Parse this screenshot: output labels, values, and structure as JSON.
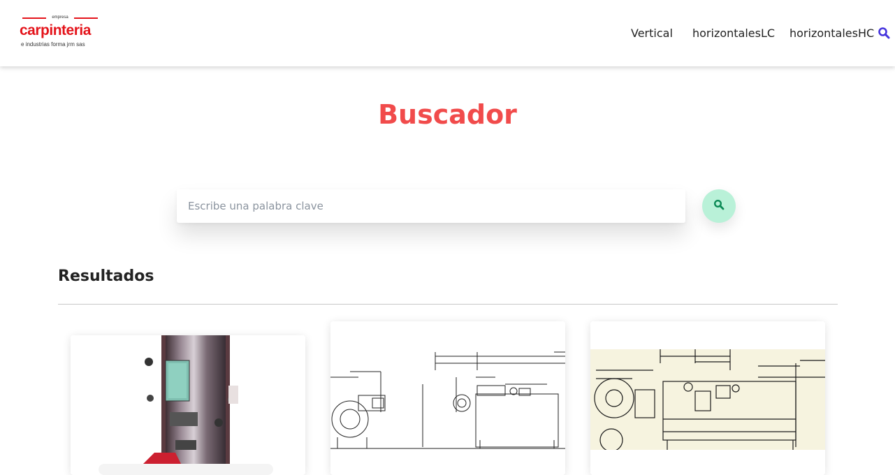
{
  "header": {
    "logo": {
      "small": "empresa",
      "brand": "carpinteria",
      "sub": "e industrias forma jrm sas"
    },
    "nav": [
      {
        "label": "Vertical"
      },
      {
        "label": "horizontalesLC"
      },
      {
        "label": "horizontalesHC"
      }
    ],
    "search_icon": "search-icon"
  },
  "main": {
    "title": "Buscador",
    "search": {
      "placeholder": "Escribe una palabra clave",
      "value": "",
      "button_icon": "search-icon"
    },
    "results_title": "Resultados",
    "results": [
      {
        "image": "vertical-boiler-photo"
      },
      {
        "image": "horizontal-boiler-drawing"
      },
      {
        "image": "horizontal-boiler-drawing-scan"
      }
    ]
  },
  "colors": {
    "brand_red": "#e4141b",
    "title_red": "#f14b4b",
    "nav_icon": "#4433dd",
    "search_button_bg": "#b9f1d8",
    "search_button_icon": "#0b8a55"
  }
}
